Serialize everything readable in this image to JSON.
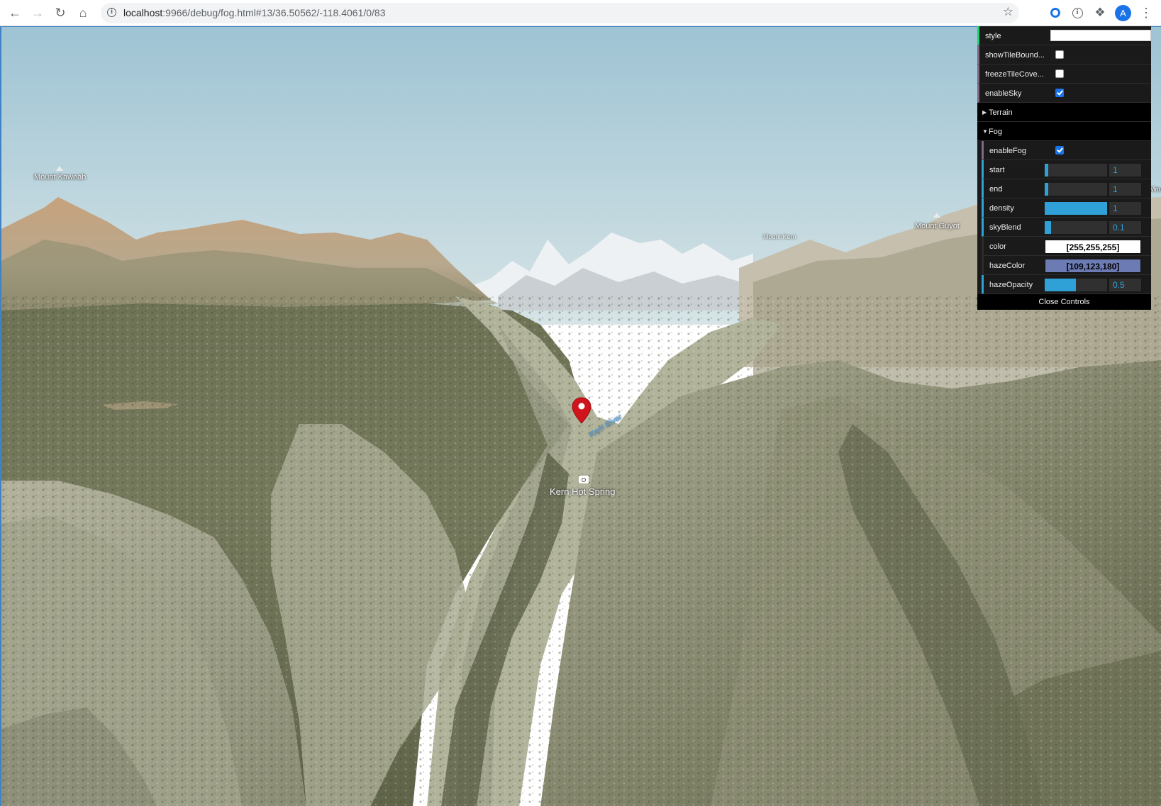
{
  "browser": {
    "url_host": "localhost",
    "url_path": ":9966/debug/fog.html#13/36.50562/-118.4061/0/83",
    "avatar_letter": "A",
    "icons": [
      "back-icon",
      "forward-icon",
      "reload-icon",
      "home-icon",
      "info-icon",
      "star-icon",
      "extension-icon",
      "puzzle-icon",
      "more-icon"
    ]
  },
  "map": {
    "labels": {
      "mount_kaweah": "Mount Kaweah",
      "mount_guyot": "Mount Guyot",
      "mount_kern": "Mount Kern",
      "kern_hot_spring": "Kern Hot Spring",
      "kern_river": "Kern River",
      "edge_label": "Mou"
    },
    "sky_top": "#9ec3d3",
    "sky_bottom": "#d5e3e6",
    "marker_color": "#d0141c"
  },
  "gui": {
    "rows": {
      "style": "style",
      "show_tile_boundaries": "showTileBound...",
      "freeze_tile_coverage": "freezeTileCove...",
      "enable_sky": "enableSky"
    },
    "values": {
      "style": "",
      "show_tile_boundaries": false,
      "freeze_tile_coverage": false,
      "enable_sky": true
    },
    "folders": {
      "terrain": "Terrain",
      "fog": "Fog"
    },
    "fog": {
      "enable_fog_label": "enableFog",
      "enable_fog": true,
      "start_label": "start",
      "start_value": "1",
      "start_fraction": 0.06,
      "end_label": "end",
      "end_value": "1",
      "end_fraction": 0.06,
      "density_label": "density",
      "density_value": "1",
      "density_fraction": 1.0,
      "sky_blend_label": "skyBlend",
      "sky_blend_value": "0.1",
      "sky_blend_fraction": 0.1,
      "color_label": "color",
      "color_value": "[255,255,255]",
      "color_hex": "#ffffff",
      "haze_color_label": "hazeColor",
      "haze_color_value": "[109,123,180]",
      "haze_color_hex": "#6d7bb4",
      "haze_opacity_label": "hazeOpacity",
      "haze_opacity_value": "0.5",
      "haze_opacity_fraction": 0.5
    },
    "close_label": "Close Controls"
  }
}
